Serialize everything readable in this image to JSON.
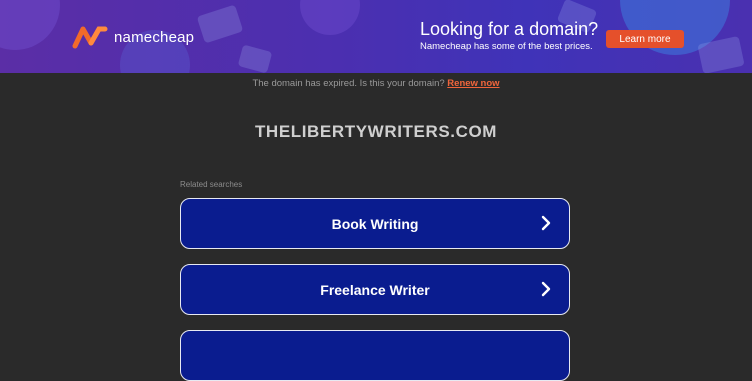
{
  "banner": {
    "brand": "namecheap",
    "headline": "Looking for a domain?",
    "subline": "Namecheap has some of the best prices.",
    "cta_label": "Learn more",
    "colors": {
      "accent": "#e5502b",
      "background": "#4b2fb0"
    }
  },
  "notice": {
    "text": "The domain has expired. Is this your domain?",
    "link_label": "Renew now"
  },
  "domain": "THELIBERTYWRITERS.COM",
  "related": {
    "label": "Related searches",
    "items": [
      {
        "label": "Book Writing"
      },
      {
        "label": "Freelance Writer"
      },
      {
        "label": ""
      }
    ]
  },
  "icons": {
    "logo": "namecheap-logo-icon",
    "chevron": "chevron-right-icon"
  },
  "colors": {
    "page": "#2a2a2a",
    "button": "#0a1c8f",
    "link": "#f0653b"
  }
}
